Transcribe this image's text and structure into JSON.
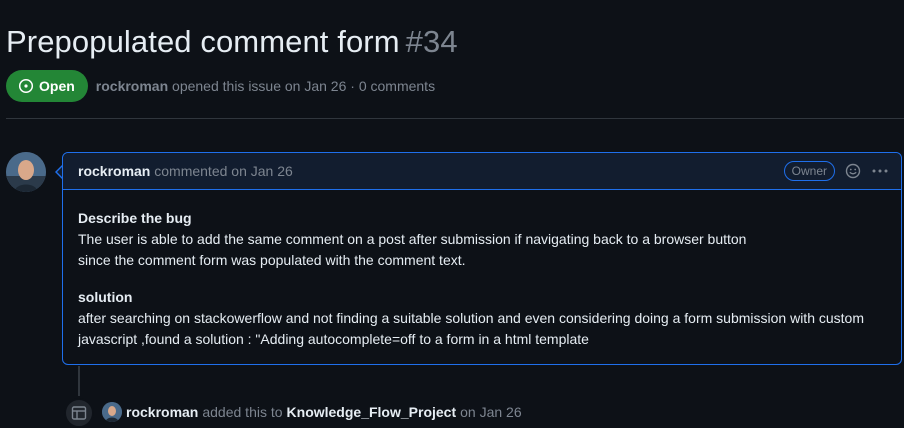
{
  "issue": {
    "title": "Prepopulated comment form",
    "number": "#34",
    "state_label": "Open",
    "author": "rockroman",
    "opened_text": "opened this issue on Jan 26 · 0 comments"
  },
  "comment": {
    "author": "rockroman",
    "action_text": "commented on Jan 26",
    "role_badge": "Owner",
    "body": {
      "heading1": "Describe the bug",
      "line1": "The user is able to add the same comment on a post after submission if navigating back to a browser button",
      "line2": "since the comment form was populated with the comment text.",
      "heading2": "solution",
      "line3": "after searching on stackowerflow and not finding a suitable solution and even considering doing a form submission with custom",
      "line4": "javascript ,found a solution : \"Adding autocomplete=off to a form in a html template"
    }
  },
  "timeline_event": {
    "author": "rockroman",
    "action_text": "added this to",
    "project": "Knowledge_Flow_Project",
    "date_text": "on Jan 26"
  },
  "icons": {
    "state": "issue-opened-icon",
    "emoji": "smiley-icon",
    "more": "kebab-horizontal-icon",
    "timeline": "project-table-icon"
  },
  "colors": {
    "open_green": "#238636",
    "accent_blue": "#1f6feb",
    "background": "#0d1117",
    "muted_text": "#7d8590"
  }
}
